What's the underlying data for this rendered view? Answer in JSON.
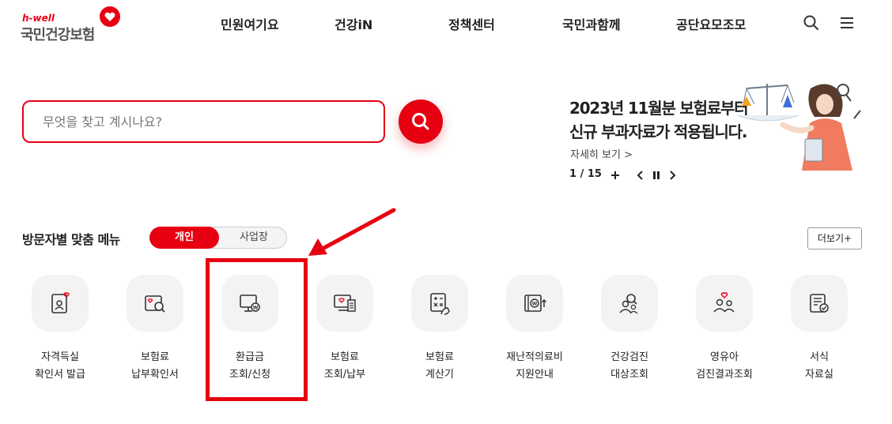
{
  "logo": {
    "brand_small": "h-well",
    "brand_name": "국민건강보험"
  },
  "nav": [
    {
      "label": "민원여기요"
    },
    {
      "label": "건강iN"
    },
    {
      "label": "정책센터"
    },
    {
      "label": "국민과함께"
    },
    {
      "label": "공단요모조모"
    }
  ],
  "header_icons": [
    "search-icon",
    "hamburger-menu-icon"
  ],
  "search": {
    "placeholder": "무엇을 찾고 계시나요?",
    "value": ""
  },
  "banner": {
    "title_line1": "2023년 11월분 보험료부터",
    "title_line2": "신규 부과자료가 적용됩니다.",
    "more_link": "자세히 보기 >",
    "page_current": "1",
    "page_separator": " / ",
    "page_total": "15"
  },
  "menu_section": {
    "title": "방문자별 맞춤 메뉴",
    "toggle": {
      "active": "개인",
      "inactive": "사업장"
    },
    "more_button": "더보기+",
    "items": [
      {
        "line1": "자격득실",
        "line2": "확인서 발급",
        "icon": "id-card-heart-icon"
      },
      {
        "line1": "보험료",
        "line2": "납부확인서",
        "icon": "document-search-icon"
      },
      {
        "line1": "환급금",
        "line2": "조회/신청",
        "icon": "monitor-won-icon"
      },
      {
        "line1": "보험료",
        "line2": "조회/납부",
        "icon": "monitor-receipt-icon"
      },
      {
        "line1": "보험료",
        "line2": "계산기",
        "icon": "calculator-hand-icon"
      },
      {
        "line1": "재난적의료비",
        "line2": "지원안내",
        "icon": "book-won-arrow-icon"
      },
      {
        "line1": "건강검진",
        "line2": "대상조회",
        "icon": "people-search-icon"
      },
      {
        "line1": "영유아",
        "line2": "검진결과조회",
        "icon": "family-heart-icon"
      },
      {
        "line1": "서식",
        "line2": "자료실",
        "icon": "document-check-icon"
      }
    ]
  },
  "colors": {
    "brand_red": "#e60012",
    "icon_bg": "#f3f3f3"
  }
}
